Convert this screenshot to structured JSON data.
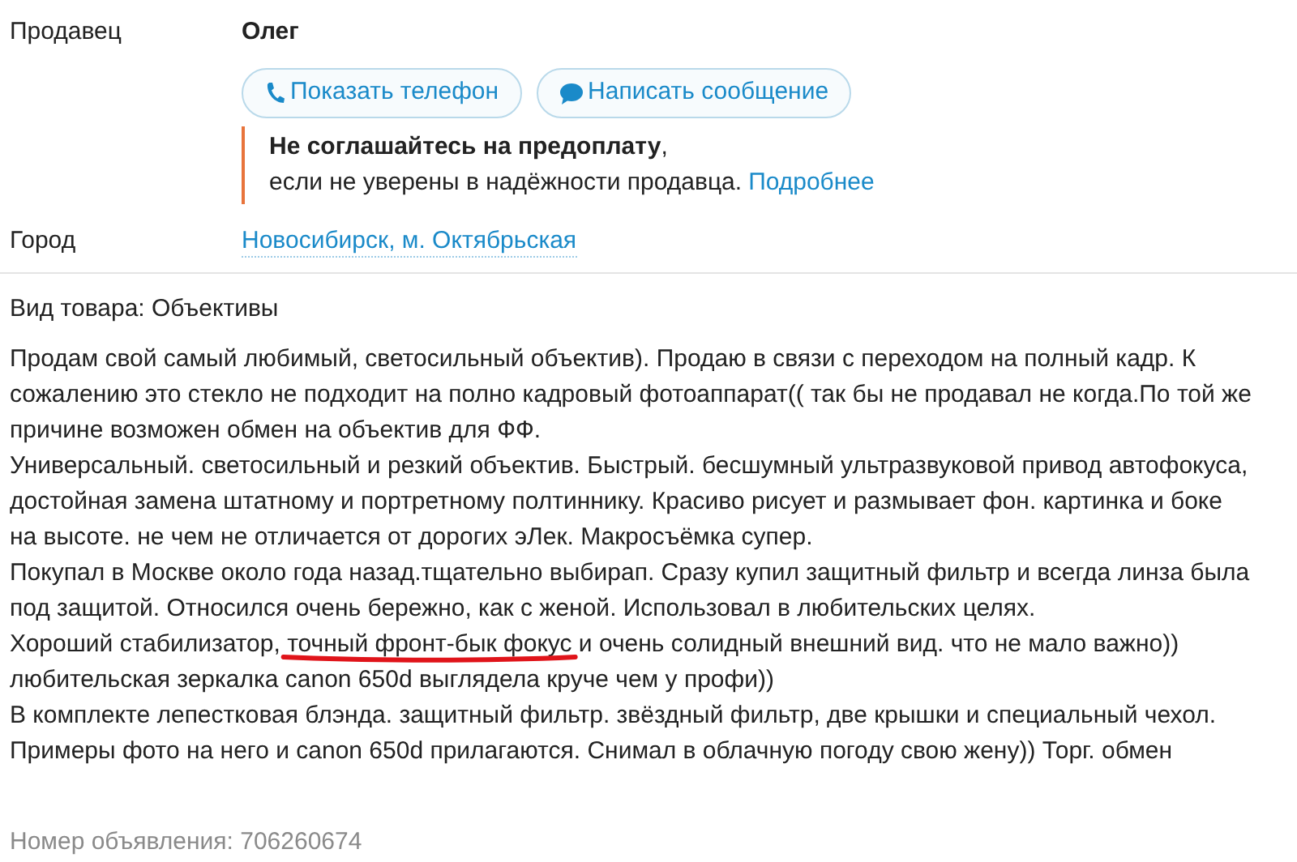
{
  "seller": {
    "label": "Продавец",
    "name": "Олег",
    "buttons": [
      {
        "kind": "phone",
        "label": "Показать телефон"
      },
      {
        "kind": "message",
        "label": "Написать сообщение"
      }
    ],
    "warning": {
      "title": "Не соглашайтесь на предоплату",
      "title_tail": ",",
      "text": "если не уверены в надёжности продавца.",
      "link": "Подробнее"
    }
  },
  "city": {
    "label": "Город",
    "value": "Новосибирск, м. Октябрьская"
  },
  "category": "Вид товара: Объективы",
  "description_lines": [
    [
      {
        "text": "Продам свой самый любимый, светосильный объектив). Продаю в связи с переходом на полный кадр. К"
      }
    ],
    [
      {
        "text": "сожалению это стекло не подходит на полно кадровый фотоаппарат(( так бы не продавал не когда.По той же"
      }
    ],
    [
      {
        "text": "причине возможен обмен на объектив для ФФ."
      }
    ],
    [
      {
        "text": "Универсальный. светосильный и резкий объектив. Быстрый. бесшумный ультразвуковой привод автофокуса,"
      }
    ],
    [
      {
        "text": "достойная замена штатному и портретному полтиннику. Красиво рисует и размывает фон. картинка и боке"
      }
    ],
    [
      {
        "text": "на высоте. не чем не отличается от дорогих эЛек. Макросъёмка супер."
      }
    ],
    [
      {
        "text": "Покупал в Москве около года назад.тщательно выбирап. Сразу купил защитный фильтр и всегда линза была"
      }
    ],
    [
      {
        "text": "под защитой. Относился очень бережно, как с женой. Использовал в любительских целях."
      }
    ],
    [
      {
        "text": "Хороший стабилизатор, "
      },
      {
        "text": "точный фронт-бык фокус",
        "kind": "underlined"
      },
      {
        "text": " и очень солидный внешний вид. что не мало важно))"
      }
    ],
    [
      {
        "text": "любительская зеркалка canon 650d выглядела круче чем у профи))"
      }
    ],
    [
      {
        "text": "В комплекте лепестковая блэнда. защитный фильтр. звёздный фильтр, две крышки и специальный чехол."
      }
    ],
    [
      {
        "text": "Примеры фото на него и canon 650d прилагаются. Снимал в облачную погоду свою жену)) Торг. обмен"
      }
    ]
  ],
  "ad_number": "Номер объявления: 706260674"
}
